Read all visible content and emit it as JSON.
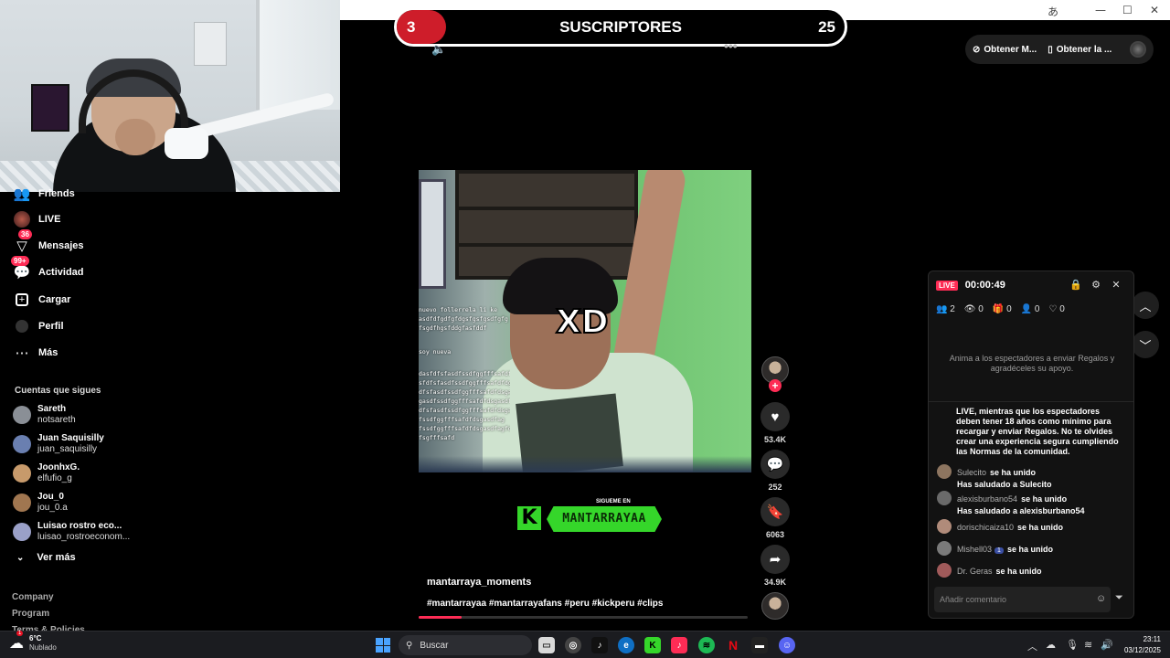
{
  "title_bar": {
    "translate_glyph": "あ",
    "minimize": "—",
    "maximize": "☐",
    "close": "✕"
  },
  "overlay": {
    "sub_count": "3",
    "title": "SUSCRIPTORES",
    "goal": "25"
  },
  "top_actions": {
    "get_coins": "Obtener M...",
    "get_app": "Obtener la ..."
  },
  "sidebar": {
    "items": [
      {
        "label": "Friends",
        "icon": "friends-icon",
        "badge": ""
      },
      {
        "label": "LIVE",
        "icon": "live-icon",
        "badge": ""
      },
      {
        "label": "Mensajes",
        "icon": "messages-icon",
        "badge": "36"
      },
      {
        "label": "Actividad",
        "icon": "activity-icon",
        "badge": "99+"
      },
      {
        "label": "Cargar",
        "icon": "upload-icon",
        "badge": ""
      },
      {
        "label": "Perfil",
        "icon": "profile-icon",
        "badge": ""
      },
      {
        "label": "Más",
        "icon": "more-icon",
        "badge": ""
      }
    ],
    "following_title": "Cuentas que sigues",
    "following": [
      {
        "name": "Sareth",
        "handle": "notsareth",
        "color": "#8a8f96"
      },
      {
        "name": "Juan Saquisilly",
        "handle": "juan_saquisilly",
        "color": "#6a7fb0"
      },
      {
        "name": "JoonhxG.",
        "handle": "elfufio_g",
        "color": "#c79a6b"
      },
      {
        "name": "Jou_0",
        "handle": "jou_0.a",
        "color": "#a07650"
      },
      {
        "name": "Luisao rostro eco...",
        "handle": "luisao_rostroeconom...",
        "color": "#9aa0c8"
      }
    ],
    "see_more": "Ver más",
    "footer": [
      "Company",
      "Program",
      "Terms & Policies"
    ]
  },
  "video": {
    "overlay_text": "XD",
    "scribble_top": [
      "nuevo follerrela li ke",
      "asdfdfgdfgfdgsfgsfgsdfgfg",
      "fsgdfhgsfddgfasfddf"
    ],
    "scribble_mid": "soy nueva",
    "scribble_bottom": [
      "dasfdfsfasdfssdfggfffsafdfd",
      "sfdfsfasdfssdfggfffsafdfdg",
      "dfsfasdfssdfggfffsafdfdsgas",
      "gasdfssdfggfffsafdfdsgasdf",
      "dfsfasdfssdfggfffsafdfdsgasd",
      "fssdfggfffsafdfdsgasdfag",
      "fssdfggfffsafdfdsgasdfagfd",
      "fsgfffsafd"
    ]
  },
  "kick": {
    "follow_me": "SIGUEME EN",
    "channel": "MANTARRAYAA",
    "letter": "K"
  },
  "post": {
    "author": "mantarraya_moments",
    "hashtags": "#mantarrayaa #mantarrayafans #peru #kickperu #clips",
    "progress": 0.13
  },
  "actions": {
    "likes": "53.4K",
    "comments": "252",
    "saves": "6063",
    "shares": "34.9K"
  },
  "live_panel": {
    "tag": "LIVE",
    "timer": "00:00:49",
    "stats": [
      "2",
      "0",
      "0",
      "0",
      "0"
    ],
    "invite": "Anima a los espectadores a enviar Regalos y agradéceles su apoyo.",
    "notice": "LIVE, mientras que los espectadores deben tener 18 años como mínimo para recargar y enviar Regalos. No te olvides crear una experiencia segura cumpliendo las Normas de la comunidad.",
    "messages": [
      {
        "user": "Sulecito",
        "action": "se ha unido",
        "sub": "Has saludado a Sulecito",
        "chip": "",
        "color": "#8d7560"
      },
      {
        "user": "alexisburbano54",
        "action": "se ha unido",
        "sub": "Has saludado a alexisburbano54",
        "chip": "",
        "color": "#6a6a6a"
      },
      {
        "user": "dorischicaiza10",
        "action": "se ha unido",
        "sub": "",
        "chip": "",
        "color": "#b08b7a"
      },
      {
        "user": "Mishell03",
        "action": "se ha unido",
        "sub": "",
        "chip": "1",
        "color": "#7a7a7a"
      },
      {
        "user": "Dr. Geras",
        "action": "se ha unido",
        "sub": "",
        "chip": "",
        "color": "#a05a5a"
      }
    ],
    "comment_placeholder": "Añadir comentario"
  },
  "taskbar": {
    "weather_temp": "6°C",
    "weather_cond": "Nublado",
    "weather_badge": "1",
    "search_placeholder": "Buscar",
    "time": "23:11",
    "date": "03/12/2025"
  }
}
